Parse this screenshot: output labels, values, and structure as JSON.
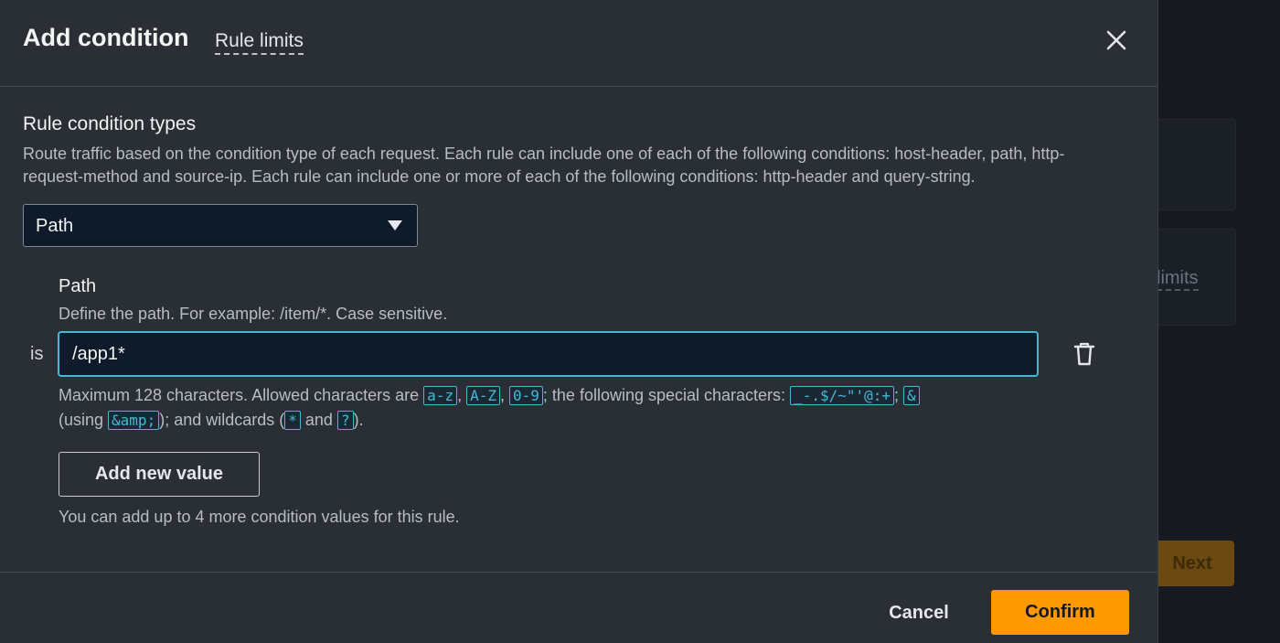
{
  "background": {
    "limits_text": "limits",
    "next_label": "Next"
  },
  "modal": {
    "title": "Add condition",
    "rule_limits_link": "Rule limits",
    "close_icon": "close-icon"
  },
  "condition_types": {
    "title": "Rule condition types",
    "description": "Route traffic based on the condition type of each request. Each rule can include one of each of the following conditions: host-header, path, http-request-method and source-ip. Each rule can include one or more of each of the following conditions: http-header and query-string.",
    "selected": "Path"
  },
  "path_field": {
    "label": "Path",
    "description": "Define the path. For example: /item/*. Case sensitive.",
    "operator": "is",
    "value": "/app1*",
    "delete_icon": "trash-icon",
    "constraint": {
      "p1": "Maximum 128 characters. Allowed characters are ",
      "c1": "a-z",
      "s1": ", ",
      "c2": "A-Z",
      "s2": ", ",
      "c3": "0-9",
      "p2": "; the following special characters: ",
      "c4": "_-.$/~\"'@:+",
      "s3": "; ",
      "c5": "&",
      "p3": " (using ",
      "c6": "&amp;",
      "p4": "); and wildcards (",
      "c7": "*",
      "p5": " and ",
      "c8": "?",
      "p6": ")."
    }
  },
  "add_value": {
    "label": "Add new value",
    "hint": "You can add up to 4 more condition values for this rule."
  },
  "footer": {
    "cancel": "Cancel",
    "confirm": "Confirm"
  },
  "colors": {
    "accent": "#ff9900",
    "focus": "#44b9d6"
  }
}
